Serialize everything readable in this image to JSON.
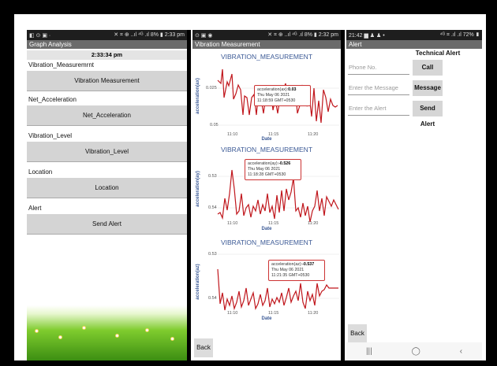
{
  "panel1": {
    "status": {
      "left": "◧ ⊙ ▣ ·",
      "right": "✕ ⌗ ⊕ ..ıl ⁴ᴳ .ıl 8% ▮ 2:33 pm"
    },
    "title": "Graph Analysis",
    "time": "2:33:34 pm",
    "rows": [
      {
        "label": "Vibration_Measuremrnt",
        "button": "Vibration Measurement"
      },
      {
        "label": "Net_Acceleration",
        "button": "Net_Acceleration"
      },
      {
        "label": "Vibration_Level",
        "button": "Vibration_Level"
      },
      {
        "label": "Location",
        "button": "Location"
      },
      {
        "label": "Alert",
        "button": "Send Alert"
      }
    ]
  },
  "panel2": {
    "status": {
      "left": "⊙ ▣ ◉",
      "right": "✕ ⌗ ⊕ ..ıl ⁴ᴳ .ıl 8% ▮ 2:32 pm"
    },
    "title": "Vibration Measurement",
    "back": "Back",
    "charts": [
      {
        "title": "VIBRATION_MEASUREMENT",
        "ylabel": "acceleration(ax)",
        "xlabel": "Date",
        "yticks": [
          "0.025",
          "0.05"
        ],
        "xticks": [
          "11:10",
          "11:15",
          "11:20"
        ],
        "tooltip": {
          "label": "acceleration(ax):",
          "value": "0.03",
          "date": "Thu May 06 2021",
          "time": "11:18:59 GMT+0530"
        }
      },
      {
        "title": "VIBRATION_MEASUREMENT",
        "ylabel": "acceleration(ay)",
        "xlabel": "Date",
        "yticks": [
          "0.53",
          "0.54"
        ],
        "xticks": [
          "11:10",
          "11:15",
          "11:20"
        ],
        "tooltip": {
          "label": "acceleration(ay):",
          "value": "-0.526",
          "date": "Thu May 06 2021",
          "time": "11:18:28 GMT+0530"
        }
      },
      {
        "title": "VIBRATION_MEASUREMENT",
        "ylabel": "acceleration(az)",
        "xlabel": "Date",
        "yticks": [
          "0.53",
          "0.54"
        ],
        "xticks": [
          "11:10",
          "11:15",
          "11:20"
        ],
        "tooltip": {
          "label": "acceleration(az):",
          "value": "-0.537",
          "date": "Thu May 06 2021",
          "time": "11:21:35 GMT+0530"
        }
      }
    ]
  },
  "panel3": {
    "status": {
      "left": "21:42 ▆ ♟ ♟ •",
      "right": "⁴ᴳ ⌗ .ıl .ıl 72% ▮"
    },
    "title": "Alert",
    "heading": "Technical Alert",
    "inputs": [
      {
        "placeholder": "Phone No.",
        "button": "Call"
      },
      {
        "placeholder": "Enter the Message",
        "button": "Message"
      },
      {
        "placeholder": "Enter the Alert",
        "button": "Send Alert"
      }
    ],
    "back": "Back",
    "nav": {
      "recent": "|||",
      "home": "◯",
      "back": "‹"
    }
  },
  "colors": {
    "series": "#c0161c",
    "title": "#3c5a96",
    "button": "#d4d4d4"
  }
}
